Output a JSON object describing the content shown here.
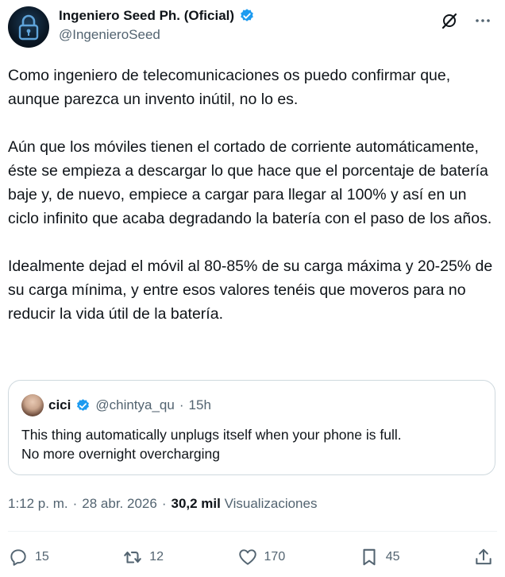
{
  "author": {
    "display_name": "Ingeniero Seed Ph. (Oficial)",
    "handle": "@IngenieroSeed",
    "verified_icon": "verified-badge-icon",
    "avatar_icon": "padlock-icon"
  },
  "tweet": {
    "text": "Como ingeniero de telecomunicaciones os puedo confirmar que, aunque parezca un invento inútil, no lo es.\n\nAún que los móviles tienen el cortado de corriente automáticamente, éste se empieza a descargar lo que hace que el porcentaje de batería baje y, de nuevo, empiece a cargar para llegar al 100% y así en un ciclo infinito que acaba degradando la batería con el paso de los años.\n\nIdealmente dejad el móvil al 80-85% de su carga máxima y 20-25% de su carga mínima, y entre esos valores tenéis que moveros para no reducir la vida útil de la batería."
  },
  "quote": {
    "name": "cici",
    "handle": "@chintya_qu",
    "separator": "·",
    "time": "15h",
    "text": "This thing automatically unplugs itself when your phone is full.\nNo more overnight overcharging"
  },
  "meta": {
    "time": "1:12 p. m.",
    "separator1": "·",
    "date": "28 abr. 2026",
    "separator2": "·",
    "views_count": "30,2 mil",
    "views_label": "Visualizaciones"
  },
  "actions": {
    "replies": "15",
    "reposts": "12",
    "likes": "170",
    "bookmarks": "45"
  },
  "colors": {
    "accent": "#1d9bf0",
    "text": "#0f1419",
    "muted": "#536471",
    "border": "#cfd9de"
  }
}
